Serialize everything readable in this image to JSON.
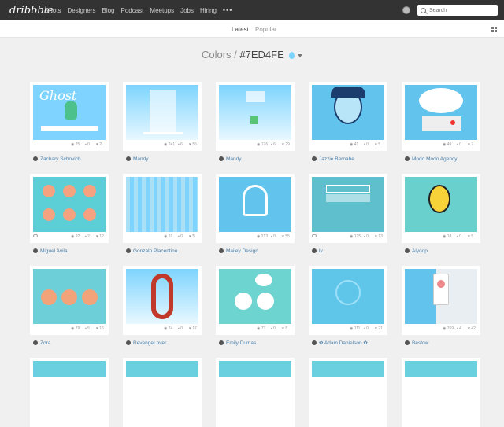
{
  "app": {
    "logo": "dribbble"
  },
  "nav": {
    "items": [
      "Shots",
      "Designers",
      "Blog",
      "Podcast",
      "Meetups",
      "Jobs",
      "Hiring"
    ],
    "more": "•••"
  },
  "search": {
    "placeholder": "Search"
  },
  "tabs": {
    "latest": "Latest",
    "popular": "Popular"
  },
  "heading": {
    "section": "Colors",
    "separator": "/",
    "color": "#7ED4FE"
  },
  "colors": {
    "accent": "#7ED4FE",
    "link": "#4B7FA9",
    "topbar": "#333333"
  },
  "shots": [
    {
      "views": "25",
      "comments": "0",
      "likes": "2",
      "author": "Zachary Schovich",
      "has_link": false
    },
    {
      "views": "241",
      "comments": "6",
      "likes": "55",
      "author": "Mandy",
      "has_link": false
    },
    {
      "views": "126",
      "comments": "6",
      "likes": "29",
      "author": "Mandy",
      "has_link": false
    },
    {
      "views": "41",
      "comments": "0",
      "likes": "5",
      "author": "Jazzie Bernabe",
      "has_link": false
    },
    {
      "views": "49",
      "comments": "0",
      "likes": "7",
      "author": "Modo Modo Agency",
      "has_link": false
    },
    {
      "views": "92",
      "comments": "2",
      "likes": "12",
      "author": "Miguel Avila",
      "has_link": true
    },
    {
      "views": "31",
      "comments": "0",
      "likes": "5",
      "author": "Gonzalo Placentino",
      "has_link": false
    },
    {
      "views": "213",
      "comments": "0",
      "likes": "55",
      "author": "Mailey Design",
      "has_link": false
    },
    {
      "views": "125",
      "comments": "0",
      "likes": "13",
      "author": "lv",
      "has_link": true
    },
    {
      "views": "18",
      "comments": "0",
      "likes": "5",
      "author": "Alyoop",
      "has_link": false
    },
    {
      "views": "79",
      "comments": "5",
      "likes": "16",
      "author": "Zora",
      "has_link": false
    },
    {
      "views": "74",
      "comments": "0",
      "likes": "17",
      "author": "RevengeLover",
      "has_link": false
    },
    {
      "views": "73",
      "comments": "0",
      "likes": "8",
      "author": "Emily Dumas",
      "has_link": false
    },
    {
      "views": "111",
      "comments": "0",
      "likes": "21",
      "author": "✿ Adam Danielson ✿",
      "has_link": false
    },
    {
      "views": "769",
      "comments": "4",
      "likes": "42",
      "author": "Bestow",
      "has_link": false
    }
  ]
}
